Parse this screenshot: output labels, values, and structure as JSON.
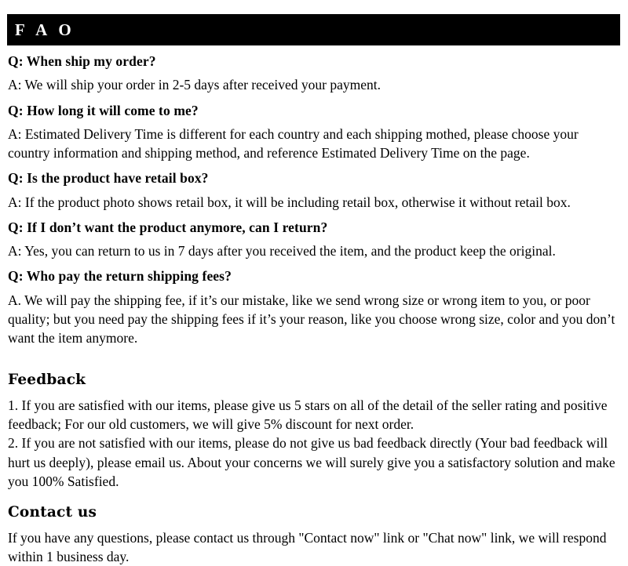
{
  "header": {
    "title": "F A O",
    "background_color": "#000000",
    "text_color": "#ffffff"
  },
  "faq": {
    "items": [
      {
        "question": "Q: When ship my order?",
        "answer": "A: We will ship your order in 2-5 days after received your payment."
      },
      {
        "question": "Q: How long it will come to me?",
        "answer": "A: Estimated Delivery Time is different for each country and each shipping mothed, please choose your country information and shipping method, and reference Estimated Delivery Time on the page."
      },
      {
        "question": "Q: Is the product have retail box?",
        "answer": "A: If  the product photo shows retail box, it will be including retail box, otherwise it without retail box."
      },
      {
        "question": "Q: If I don’t want the product anymore, can I return?",
        "answer": "A: Yes, you can return to us in 7 days after you received the item, and the product keep the original."
      },
      {
        "question": "Q: Who pay the return shipping fees?",
        "answer": "A.  We will pay the shipping fee, if  it’s our mistake, like we send wrong size or wrong item to you, or poor quality; but you need pay the shipping fees if  it’s your reason, like you choose wrong size, color and you don’t want the item anymore."
      }
    ]
  },
  "feedback": {
    "title": "Feedback",
    "paragraphs": [
      "1.  If you are satisfied with our items, please give us 5 stars on all of the detail of the seller rating and positive feedback; For our old customers, we will give 5% discount for next order.",
      "2.  If you are not satisfied with our items, please do not give us bad feedback directly (Your bad feedback will hurt us deeply), please email us. About your concerns we will surely give you a satisfactory solution and make you 100% Satisfied."
    ]
  },
  "contact": {
    "title": "Contact us",
    "paragraphs": [
      "If you have any questions, please contact us through \"Contact now\" link or \"Chat now\" link, we will respond within 1 business day."
    ]
  }
}
